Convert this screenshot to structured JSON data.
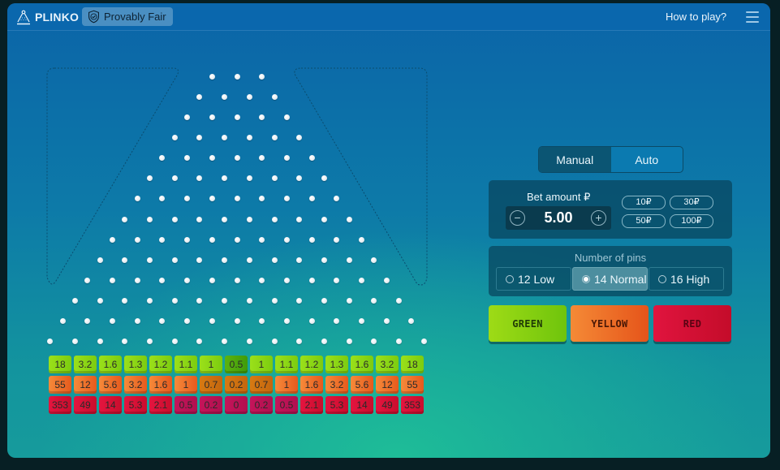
{
  "header": {
    "app_title": "PLINKO",
    "provably_fair_label": "Provably Fair",
    "how_to_play_label": "How to play?",
    "icons": {
      "logo": "plinko-triangle-icon",
      "badge": "shield-check-icon",
      "menu": "hamburger-menu-icon"
    }
  },
  "board": {
    "rows": 14,
    "first_row_pins": 3,
    "last_row_pins": 16
  },
  "multipliers": {
    "green": {
      "color": "#8fd71a",
      "values": [
        "18",
        "3.2",
        "1.6",
        "1.3",
        "1.2",
        "1.1",
        "1",
        "0.5",
        "1",
        "1.1",
        "1.2",
        "1.3",
        "1.6",
        "3.2",
        "18"
      ]
    },
    "yellow": {
      "color": "#f4782f",
      "values": [
        "55",
        "12",
        "5.6",
        "3.2",
        "1.6",
        "1",
        "0.7",
        "0.2",
        "0.7",
        "1",
        "1.6",
        "3.2",
        "5.6",
        "12",
        "55"
      ]
    },
    "red": {
      "color": "#d81846",
      "values": [
        "353",
        "49",
        "14",
        "5.3",
        "2.1",
        "0.5",
        "0.2",
        "0",
        "0.2",
        "0.5",
        "2.1",
        "5.3",
        "14",
        "49",
        "353"
      ]
    }
  },
  "mode_toggle": {
    "tabs": [
      {
        "label": "Manual",
        "active": true
      },
      {
        "label": "Auto",
        "active": false
      }
    ]
  },
  "bet": {
    "label": "Bet amount ₽",
    "value": "5.00",
    "decrease_icon": "minus-circle-icon",
    "increase_icon": "plus-circle-icon",
    "chips": [
      "10₽",
      "30₽",
      "50₽",
      "100₽"
    ]
  },
  "pins_selector": {
    "label": "Number of pins",
    "options": [
      {
        "label": "12 Low",
        "selected": false
      },
      {
        "label": "14 Normal",
        "selected": true
      },
      {
        "label": "16 High",
        "selected": false
      }
    ]
  },
  "play_buttons": {
    "green": "GREEN",
    "yellow": "YELLOW",
    "red": "RED"
  }
}
